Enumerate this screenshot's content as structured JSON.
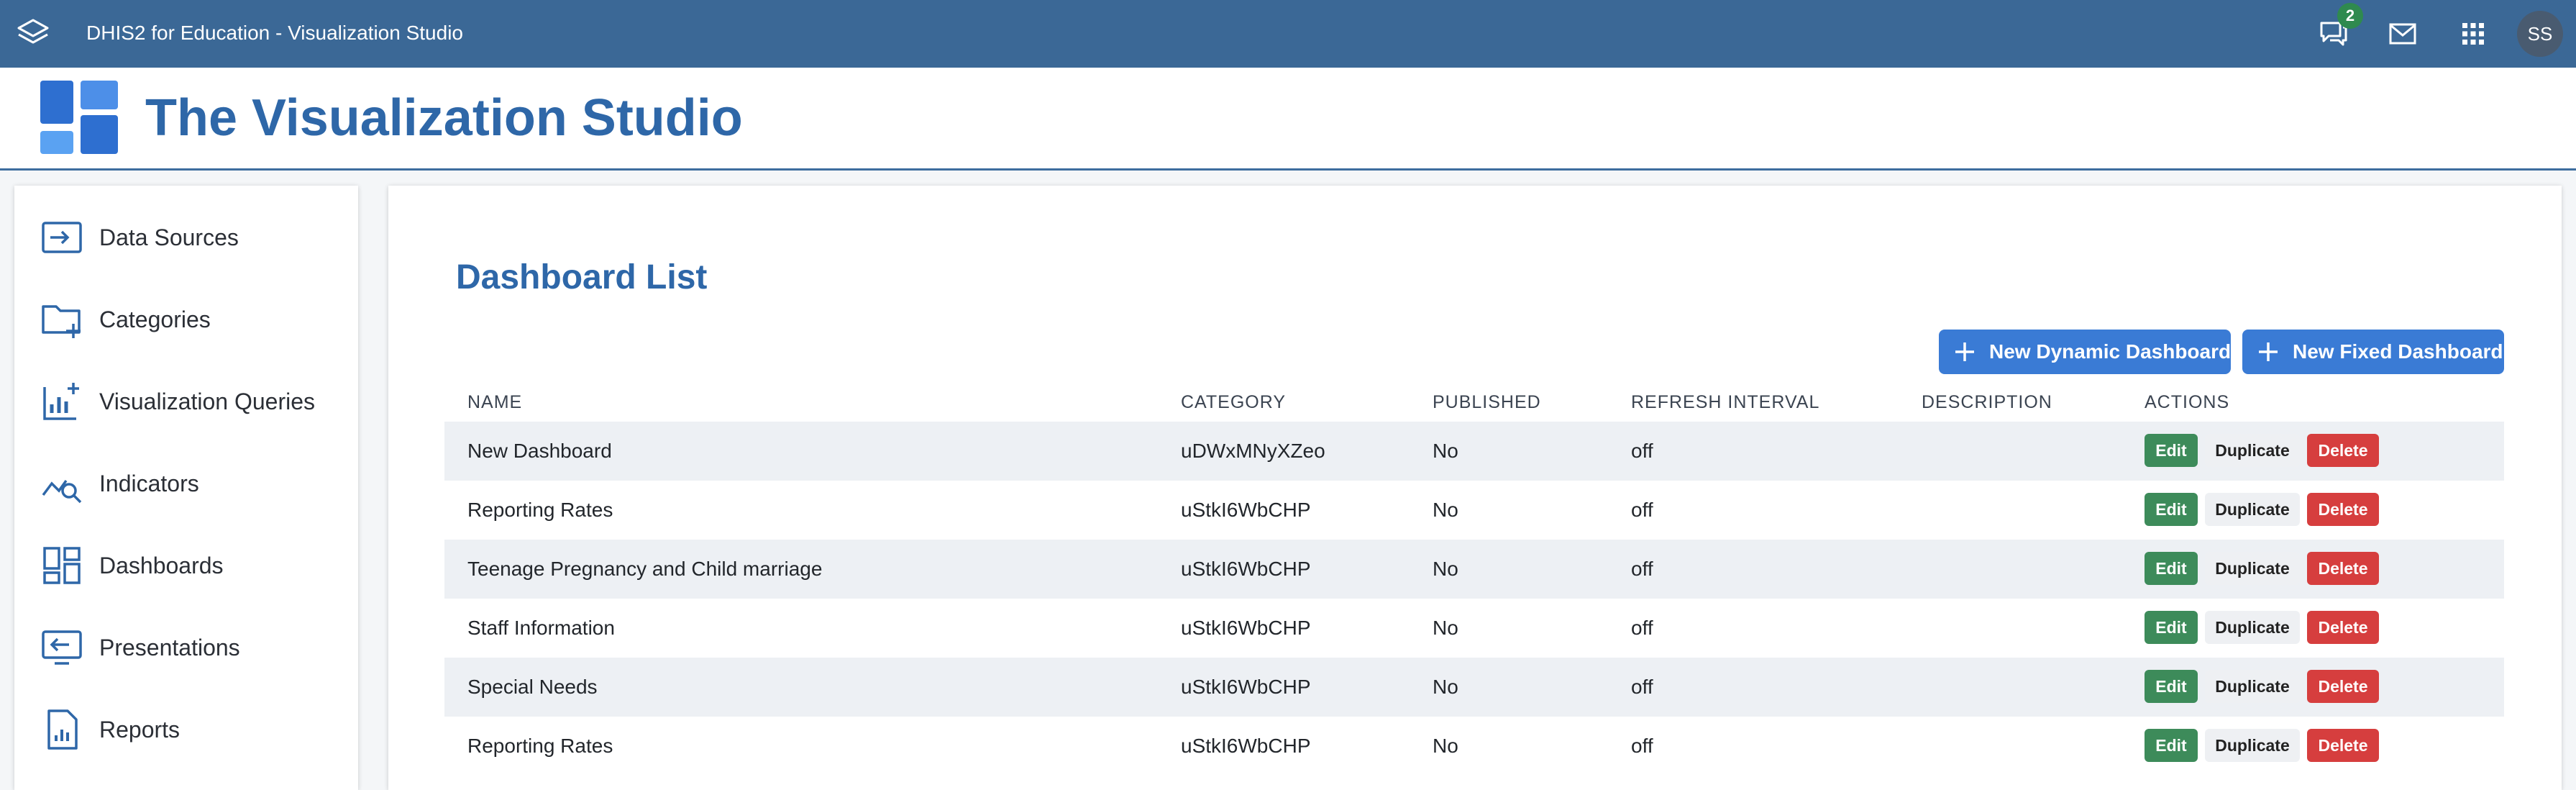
{
  "topbar": {
    "app_title": "DHIS2 for Education - Visualization Studio",
    "messages_badge": "2",
    "user_initials": "SS",
    "icons": [
      "app-logo-icon",
      "chat-icon",
      "mail-icon",
      "apps-grid-icon"
    ]
  },
  "header": {
    "title": "The Visualization Studio"
  },
  "sidebar": {
    "items": [
      {
        "label": "Data Sources",
        "icon": "data-source-icon"
      },
      {
        "label": "Categories",
        "icon": "folder-add-icon"
      },
      {
        "label": "Visualization Queries",
        "icon": "chart-add-icon"
      },
      {
        "label": "Indicators",
        "icon": "indicator-search-icon"
      },
      {
        "label": "Dashboards",
        "icon": "dashboard-icon"
      },
      {
        "label": "Presentations",
        "icon": "presentation-icon"
      },
      {
        "label": "Reports",
        "icon": "report-icon"
      }
    ]
  },
  "main": {
    "title": "Dashboard List",
    "new_dynamic_label": "New Dynamic Dashboard",
    "new_fixed_label": "New Fixed Dashboard",
    "columns": {
      "name": "NAME",
      "category": "CATEGORY",
      "published": "PUBLISHED",
      "refresh": "REFRESH INTERVAL",
      "description": "DESCRIPTION",
      "actions": "ACTIONS"
    },
    "actions": {
      "edit": "Edit",
      "duplicate": "Duplicate",
      "delete": "Delete"
    },
    "rows": [
      {
        "name": "New Dashboard",
        "category": "uDWxMNyXZeo",
        "published": "No",
        "refresh": "off",
        "description": ""
      },
      {
        "name": "Reporting Rates",
        "category": "uStkI6WbCHP",
        "published": "No",
        "refresh": "off",
        "description": ""
      },
      {
        "name": "Teenage Pregnancy and Child marriage",
        "category": "uStkI6WbCHP",
        "published": "No",
        "refresh": "off",
        "description": ""
      },
      {
        "name": "Staff Information",
        "category": "uStkI6WbCHP",
        "published": "No",
        "refresh": "off",
        "description": ""
      },
      {
        "name": "Special Needs",
        "category": "uStkI6WbCHP",
        "published": "No",
        "refresh": "off",
        "description": ""
      },
      {
        "name": "Reporting Rates",
        "category": "uStkI6WbCHP",
        "published": "No",
        "refresh": "off",
        "description": ""
      }
    ]
  },
  "colors": {
    "topbar": "#3b6896",
    "brand_blue": "#2e67a8",
    "primary_button": "#3a7bd5",
    "edit": "#3d8b5a",
    "delete": "#d63e3e"
  }
}
